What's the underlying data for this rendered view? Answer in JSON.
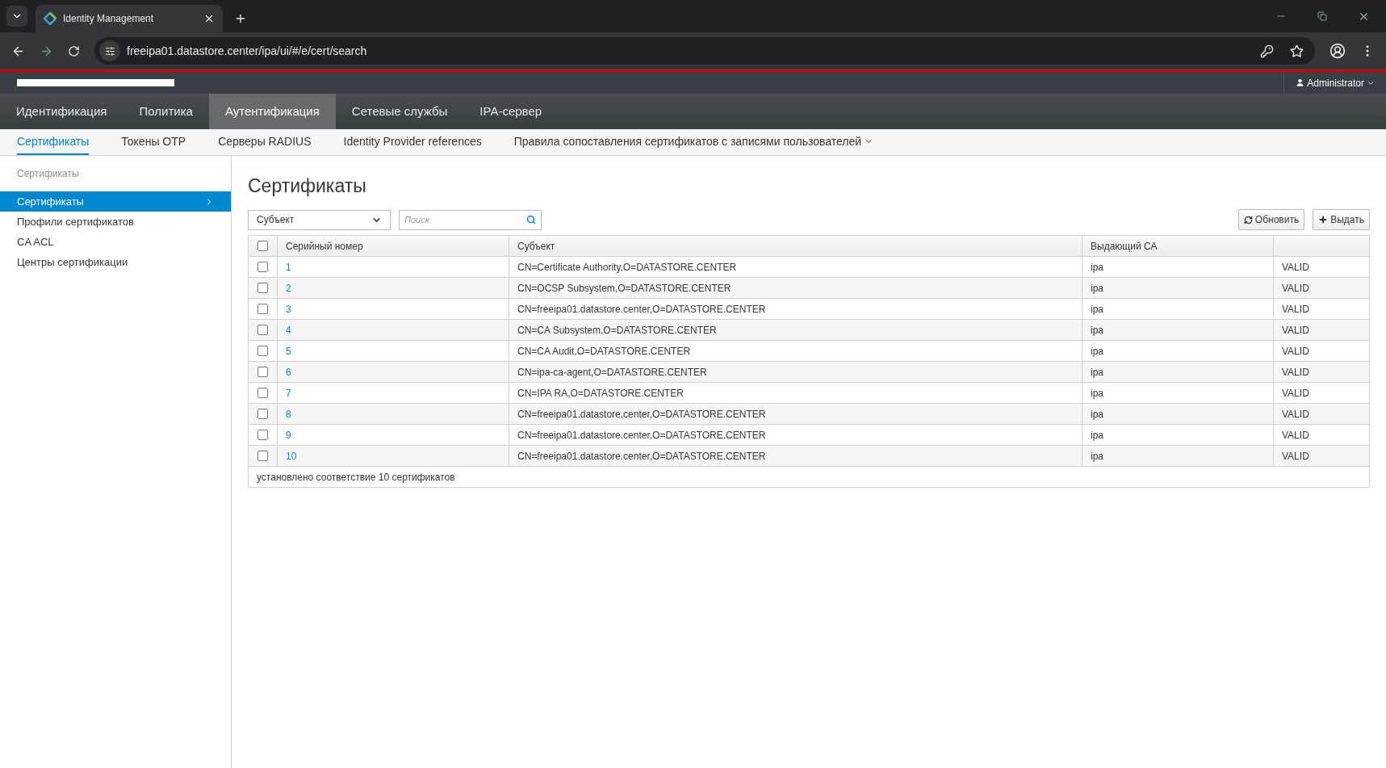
{
  "browser": {
    "tab_title": "Identity Management",
    "url": "freeipa01.datastore.center/ipa/ui/#/e/cert/search"
  },
  "header": {
    "user": "Administrator"
  },
  "nav": [
    {
      "label": "Идентификация",
      "selected": false
    },
    {
      "label": "Политика",
      "selected": false
    },
    {
      "label": "Аутентификация",
      "selected": true
    },
    {
      "label": "Сетевые службы",
      "selected": false
    },
    {
      "label": "IPA-сервер",
      "selected": false
    }
  ],
  "subnav": [
    {
      "label": "Сертификаты",
      "selected": true,
      "dropdown": false
    },
    {
      "label": "Токены OTP",
      "selected": false,
      "dropdown": false
    },
    {
      "label": "Серверы RADIUS",
      "selected": false,
      "dropdown": false
    },
    {
      "label": "Identity Provider references",
      "selected": false,
      "dropdown": false
    },
    {
      "label": "Правила сопоставления сертификатов с записями пользователей",
      "selected": false,
      "dropdown": true
    }
  ],
  "sidebar": {
    "heading": "Сертификаты",
    "items": [
      {
        "label": "Сертификаты",
        "selected": true
      },
      {
        "label": "Профили сертификатов",
        "selected": false
      },
      {
        "label": "CA ACL",
        "selected": false
      },
      {
        "label": "Центры сертификации",
        "selected": false
      }
    ]
  },
  "page_title": "Сертификаты",
  "toolbar": {
    "filter": "Субъект",
    "search_placeholder": "Поиск",
    "buttons": [
      {
        "label": "Обновить",
        "kind": "refresh"
      },
      {
        "label": "Выдать",
        "kind": "add"
      }
    ]
  },
  "table": {
    "select_all_checked": false,
    "columns": [
      "Серийный номер",
      "Субъект",
      "Выдающий CA",
      ""
    ],
    "rows": [
      {
        "checked": false,
        "serial": "1",
        "subject": "CN=Certificate Authority,O=DATASTORE.CENTER",
        "issuer": "ipa",
        "status": "VALID"
      },
      {
        "checked": false,
        "serial": "2",
        "subject": "CN=OCSP Subsystem,O=DATASTORE.CENTER",
        "issuer": "ipa",
        "status": "VALID"
      },
      {
        "checked": false,
        "serial": "3",
        "subject": "CN=freeipa01.datastore.center,O=DATASTORE.CENTER",
        "issuer": "ipa",
        "status": "VALID"
      },
      {
        "checked": false,
        "serial": "4",
        "subject": "CN=CA Subsystem,O=DATASTORE.CENTER",
        "issuer": "ipa",
        "status": "VALID"
      },
      {
        "checked": false,
        "serial": "5",
        "subject": "CN=CA Audit,O=DATASTORE.CENTER",
        "issuer": "ipa",
        "status": "VALID"
      },
      {
        "checked": false,
        "serial": "6",
        "subject": "CN=ipa-ca-agent,O=DATASTORE.CENTER",
        "issuer": "ipa",
        "status": "VALID"
      },
      {
        "checked": false,
        "serial": "7",
        "subject": "CN=IPA RA,O=DATASTORE.CENTER",
        "issuer": "ipa",
        "status": "VALID"
      },
      {
        "checked": false,
        "serial": "8",
        "subject": "CN=freeipa01.datastore.center,O=DATASTORE.CENTER",
        "issuer": "ipa",
        "status": "VALID"
      },
      {
        "checked": false,
        "serial": "9",
        "subject": "CN=freeipa01.datastore.center,O=DATASTORE.CENTER",
        "issuer": "ipa",
        "status": "VALID"
      },
      {
        "checked": false,
        "serial": "10",
        "subject": "CN=freeipa01.datastore.center,O=DATASTORE.CENTER",
        "issuer": "ipa",
        "status": "VALID"
      }
    ],
    "footer": "установлено соответствие 10 сертификатов"
  }
}
